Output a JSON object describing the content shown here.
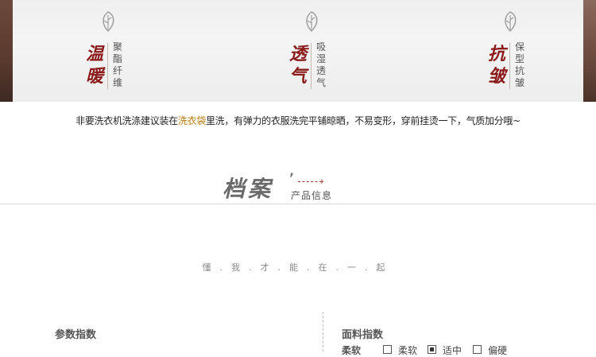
{
  "features": [
    {
      "title": "温暖",
      "subtitle": "聚酯纤维",
      "icon": "leaf-icon"
    },
    {
      "title": "透气",
      "subtitle": "吸湿透气",
      "icon": "leaf-icon"
    },
    {
      "title": "抗皱",
      "subtitle": "保型抗皱",
      "icon": "leaf-icon"
    }
  ],
  "care_note": {
    "before": "非要洗衣机洗涤建议装在",
    "highlight": "洗衣袋",
    "after": "里洗，有弹力的衣服洗完平铺晾晒，不易变形，穿前挂烫一下，气质加分哦~"
  },
  "section": {
    "title": "档案",
    "tick": "’",
    "subtitle": "产品信息",
    "arrow": "›"
  },
  "slogan": "懂.我.才.能.在.一.起",
  "param_title": "参数指数",
  "fabric": {
    "title": "面料指数",
    "row_label": "柔软",
    "options": [
      {
        "label": "柔软",
        "checked": false
      },
      {
        "label": "适中",
        "checked": true
      },
      {
        "label": "偏硬",
        "checked": false
      }
    ]
  },
  "colors": {
    "accent_red": "#8b1a1a",
    "highlight": "#b87c0c",
    "edge_brown": "#5a3a2e"
  }
}
